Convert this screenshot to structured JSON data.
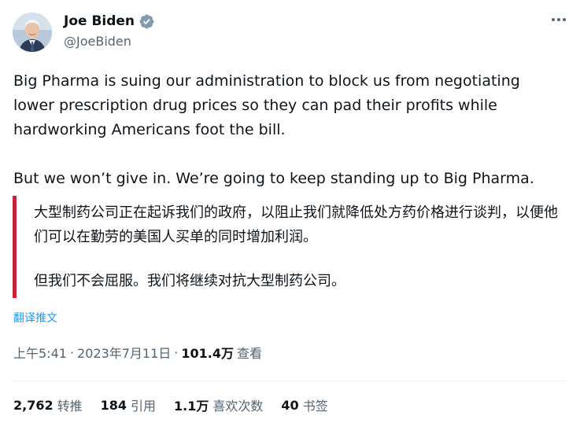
{
  "author": {
    "display_name": "Joe Biden",
    "handle": "@JoeBiden",
    "verified_color": "#829aab"
  },
  "tweet": {
    "paragraph1": "Big Pharma is suing our administration to block us from negotiating lower prescription drug prices so they can pad their profits while hardworking Americans foot the bill.",
    "paragraph2": "But we won’t give in. We’re going to keep standing up to Big Pharma."
  },
  "translation": {
    "paragraph1": "大型制药公司正在起诉我们的政府，以阻止我们就降低处方药价格进行谈判，以便他们可以在勤劳的美国人买单的同时增加利润。",
    "paragraph2": "但我们不会屈服。我们将继续对抗大型制药公司。",
    "accent_color": "#c8223b",
    "link_label": "翻译推文"
  },
  "meta": {
    "time": "上午5:41",
    "date": "2023年7月11日",
    "separator": "·",
    "views": "101.4万",
    "views_label": "查看"
  },
  "stats": [
    {
      "num": "2,762",
      "label": "转推"
    },
    {
      "num": "184",
      "label": "引用"
    },
    {
      "num": "1.1万",
      "label": "喜欢次数"
    },
    {
      "num": "40",
      "label": "书签"
    }
  ],
  "colors": {
    "link": "#1d9bf0",
    "secondary_text": "#536471",
    "primary_text": "#0f1419"
  },
  "icons": {
    "verified": "verified-badge-icon",
    "more": "more-dots-icon"
  }
}
